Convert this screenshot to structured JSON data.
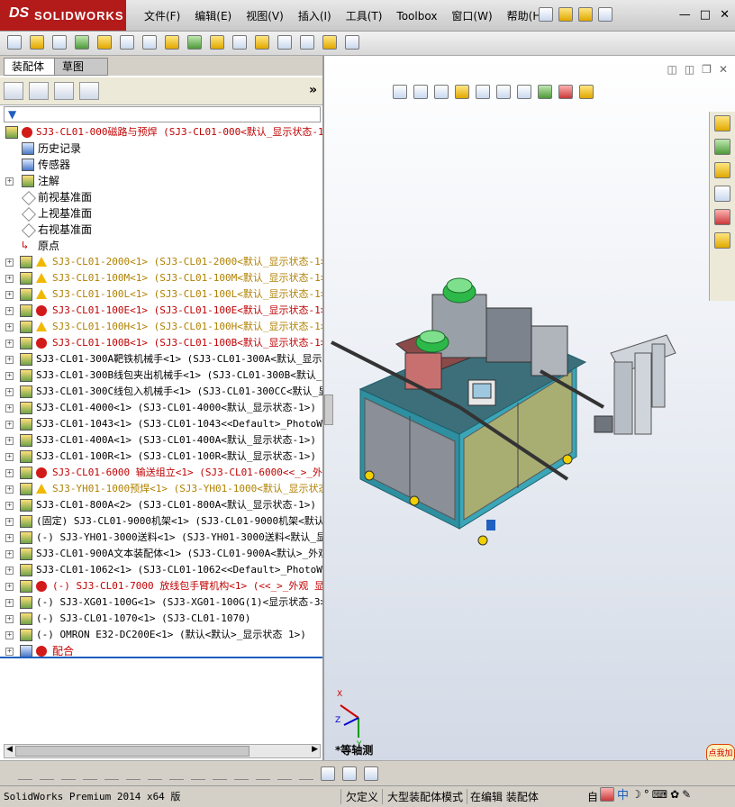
{
  "app": {
    "logo_ds": "DS",
    "logo_name": "SOLIDWORKS",
    "menu": [
      "文件(F)",
      "编辑(E)",
      "视图(V)",
      "插入(I)",
      "工具(T)",
      "Toolbox",
      "窗口(W)",
      "帮助(H)"
    ],
    "window_controls": [
      "—",
      "□",
      "✕"
    ]
  },
  "panel": {
    "tabs": [
      "装配体",
      "草图"
    ],
    "more": "»"
  },
  "tree": {
    "root": "SJ3-CL01-000磁路与预焊  (SJ3-CL01-000<默认_显示状态-1",
    "plain_items": [
      "历史记录",
      "传感器",
      "注解",
      "前视基准面",
      "上视基准面",
      "右视基准面",
      "原点"
    ],
    "components": [
      {
        "text": "SJ3-CL01-2000<1> (SJ3-CL01-2000<默认_显示状态-1>)",
        "status": "warn"
      },
      {
        "text": "SJ3-CL01-100M<1> (SJ3-CL01-100M<默认_显示状态-1>)",
        "status": "warn"
      },
      {
        "text": "SJ3-CL01-100L<1> (SJ3-CL01-100L<默认_显示状态-1>)",
        "status": "warn"
      },
      {
        "text": "SJ3-CL01-100E<1> (SJ3-CL01-100E<默认_显示状态-1>)",
        "status": "error"
      },
      {
        "text": "SJ3-CL01-100H<1> (SJ3-CL01-100H<默认_显示状态-1>)",
        "status": "warn"
      },
      {
        "text": "SJ3-CL01-100B<1> (SJ3-CL01-100B<默认_显示状态-1>)",
        "status": "error"
      },
      {
        "text": "SJ3-CL01-300A靶铁机械手<1> (SJ3-CL01-300A<默认_显示状",
        "status": "ok"
      },
      {
        "text": "SJ3-CL01-300B线包夹出机械手<1> (SJ3-CL01-300B<默认_显",
        "status": "ok"
      },
      {
        "text": "SJ3-CL01-300C线包入机械手<1> (SJ3-CL01-300CC<默认_显",
        "status": "ok"
      },
      {
        "text": "SJ3-CL01-4000<1> (SJ3-CL01-4000<默认_显示状态-1>)",
        "status": "ok"
      },
      {
        "text": "SJ3-CL01-1043<1> (SJ3-CL01-1043<<Default>_PhotoWorks",
        "status": "ok"
      },
      {
        "text": "SJ3-CL01-400A<1> (SJ3-CL01-400A<默认_显示状态-1>)",
        "status": "ok"
      },
      {
        "text": "SJ3-CL01-100R<1> (SJ3-CL01-100R<默认_显示状态-1>)",
        "status": "ok"
      },
      {
        "text": "SJ3-CL01-6000 输送组立<1> (SJ3-CL01-6000<<_>_外观",
        "status": "error"
      },
      {
        "text": "SJ3-YH01-1000预焊<1> (SJ3-YH01-1000<默认_显示状态",
        "status": "warn"
      },
      {
        "text": "SJ3-CL01-800A<2> (SJ3-CL01-800A<默认_显示状态-1>)",
        "status": "ok"
      },
      {
        "text": "(固定) SJ3-CL01-9000机架<1> (SJ3-CL01-9000机架<默认_",
        "status": "ok"
      },
      {
        "text": "(-) SJ3-YH01-3000送料<1> (SJ3-YH01-3000送料<默认_显示",
        "status": "ok"
      },
      {
        "text": "SJ3-CL01-900A文本装配体<1> (SJ3-CL01-900A<默认>_外观",
        "status": "ok"
      },
      {
        "text": "SJ3-CL01-1062<1> (SJ3-CL01-1062<<Default>_PhotoWorks",
        "status": "ok"
      },
      {
        "text": "(-) SJ3-CL01-7000 放线包手臂机构<1> (<<_>_外观 显",
        "status": "error"
      },
      {
        "text": "(-) SJ3-XG01-100G<1> (SJ3-XG01-100G(1)<显示状态-3>)",
        "status": "ok"
      },
      {
        "text": "(-) SJ3-CL01-1070<1> (SJ3-CL01-1070)",
        "status": "ok"
      },
      {
        "text": "(-) OMRON E32-DC200E<1> (默认<默认>_显示状态 1>)",
        "status": "ok"
      }
    ],
    "mates": "配合"
  },
  "viewport": {
    "view_name": "*等轴测",
    "badge": "点我加",
    "axis_x": "X",
    "axis_y": "Y",
    "axis_z": "Z"
  },
  "status": {
    "product": "SolidWorks Premium 2014 x64 版",
    "definition": "欠定义",
    "mode": "大型装配体模式",
    "editing": "在编辑 装配体",
    "custom": "自"
  },
  "ime": {
    "label": "中"
  }
}
